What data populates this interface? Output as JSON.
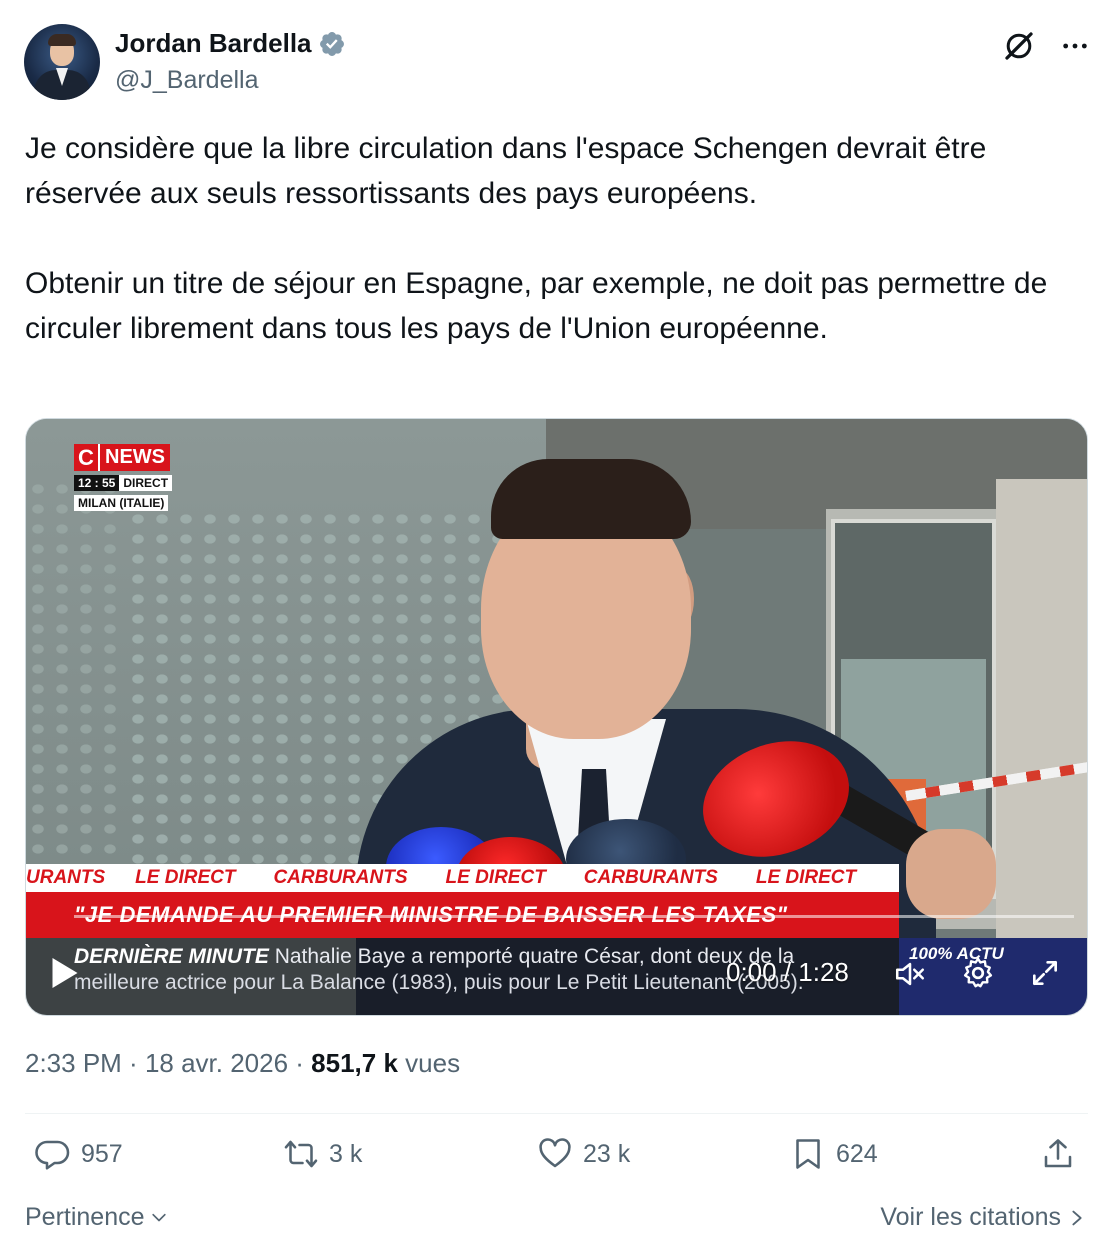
{
  "author": {
    "name": "Jordan Bardella",
    "handle": "@J_Bardella",
    "verified_color": "#829aab"
  },
  "tweet": {
    "paragraphs": [
      "Je considère que la libre circulation dans l'espace Schengen devrait être réservée aux seuls ressortissants des pays européens.",
      "Obtenir un titre de séjour en Espagne, par exemple, ne doit pas permettre de circuler librement dans tous les pays de l'Union européenne."
    ]
  },
  "video": {
    "channel_logo_c": "C",
    "channel_logo_news": "NEWS",
    "broadcast_time": "12 : 55",
    "broadcast_live": "DIRECT",
    "broadcast_location": "MILAN (ITALIE)",
    "ticker_items": [
      "URANTS",
      "LE DIRECT",
      "CARBURANTS",
      "LE DIRECT",
      "CARBURANTS",
      "LE DIRECT"
    ],
    "headline": "\"JE DEMANDE AU PREMIER MINISTRE DE BAISSER LES TAXES\"",
    "breaking_label": "DERNIÈRE MINUTE",
    "breaking_line1": " Nathalie Baye a remporté quatre César, dont deux de la",
    "breaking_line2": "meilleure actrice pour La Balance (1983), puis pour Le Petit Lieutenant (2005).",
    "corner_label": "100% ACTU",
    "time": "0:00 / 1:28",
    "brand_red": "#d8141b"
  },
  "meta": {
    "time": "2:33 PM",
    "separator": " · ",
    "date": "18 avr. 2026",
    "views": "851,7 k",
    "views_label": " vues"
  },
  "actions": {
    "reply_count": "957",
    "retweet_count": "3 k",
    "like_count": "23 k",
    "bookmark_count": "624"
  },
  "footer": {
    "sort_label": "Pertinence",
    "quotes_label": "Voir les citations"
  }
}
